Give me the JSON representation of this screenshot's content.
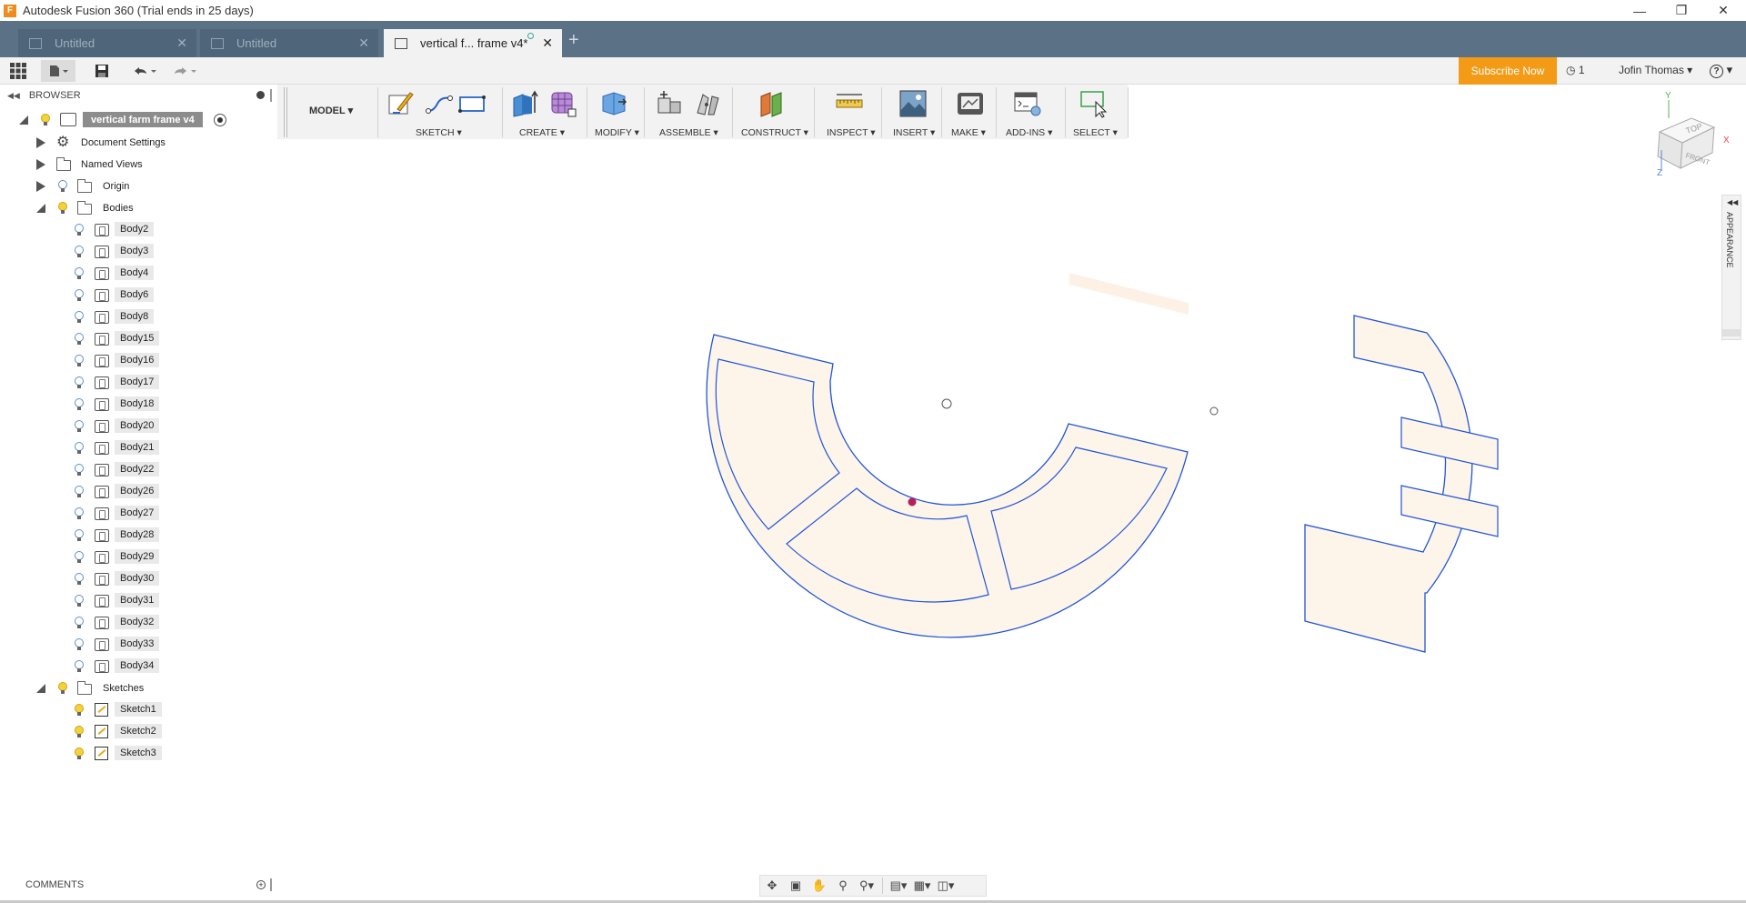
{
  "window": {
    "title": "Autodesk Fusion 360 (Trial ends in 25 days)",
    "app_logo": "F"
  },
  "tabs": [
    {
      "label": "Untitled",
      "active": false
    },
    {
      "label": "Untitled",
      "active": false
    },
    {
      "label": "vertical f... frame v4*",
      "active": true
    }
  ],
  "quickbar": {
    "subscribe_label": "Subscribe Now",
    "jobs_count": "1",
    "user_name": "Jofin Thomas",
    "help_label": "?"
  },
  "browser": {
    "title": "BROWSER",
    "root_label": "vertical farm frame v4",
    "document_settings": "Document Settings",
    "named_views": "Named Views",
    "origin": "Origin",
    "bodies_folder": "Bodies",
    "bodies": [
      "Body2",
      "Body3",
      "Body4",
      "Body6",
      "Body8",
      "Body15",
      "Body16",
      "Body17",
      "Body18",
      "Body20",
      "Body21",
      "Body22",
      "Body26",
      "Body27",
      "Body28",
      "Body29",
      "Body30",
      "Body31",
      "Body32",
      "Body33",
      "Body34"
    ],
    "sketches_folder": "Sketches",
    "sketches": [
      "Sketch1",
      "Sketch2",
      "Sketch3"
    ]
  },
  "toolbar": {
    "workspace": "MODEL",
    "groups": [
      "SKETCH",
      "CREATE",
      "MODIFY",
      "ASSEMBLE",
      "CONSTRUCT",
      "INSPECT",
      "INSERT",
      "MAKE",
      "ADD-INS",
      "SELECT"
    ]
  },
  "viewcube": {
    "top": "TOP",
    "front": "FRONT",
    "x": "X",
    "y": "Y",
    "z": "Z"
  },
  "appearance_panel": {
    "label": "APPEARANCE"
  },
  "comments": {
    "label": "COMMENTS"
  },
  "colors": {
    "accent": "#f39b17",
    "tab_bar": "#5b7186",
    "sketch_line": "#2255d6",
    "body_fill": "#fdf4ea"
  }
}
